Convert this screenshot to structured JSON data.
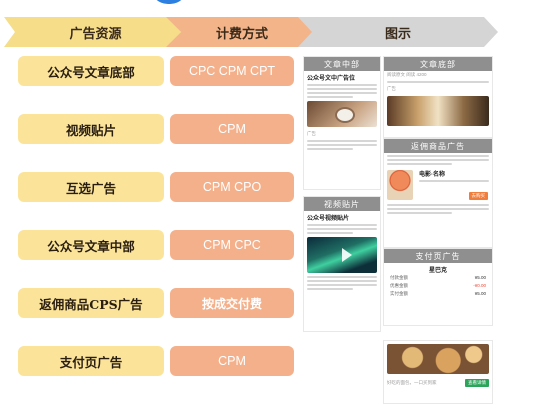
{
  "headers": {
    "source": "广告资源",
    "billing": "计费方式",
    "example": "图示"
  },
  "rows": [
    {
      "source": "公众号文章底部",
      "billing": "CPC CPM CPT"
    },
    {
      "source": "视频贴片",
      "billing": "CPM"
    },
    {
      "source": "互选广告",
      "billing": "CPM CPO"
    },
    {
      "source": "公众号文章中部",
      "billing": "CPM CPC"
    },
    {
      "source": "返佣商品CPS广告",
      "billing": "按成交付费"
    },
    {
      "source": "支付页广告",
      "billing": "CPM"
    }
  ],
  "examples": {
    "article_middle": {
      "tag": "文章中部",
      "title": "公众号文中广告位",
      "ad_label": "广告"
    },
    "video_patch": {
      "tag": "视频贴片",
      "title": "公众号视频贴片"
    },
    "article_bottom": {
      "tag": "文章底部",
      "meta": "阅读原文  阅读 4200",
      "ad_label": "广告"
    },
    "cps": {
      "tag": "返佣商品广告",
      "product": "电影·名称",
      "buy": "去购买"
    },
    "pay_page": {
      "tag": "支付页广告",
      "merchant": "星巴克",
      "rows": [
        {
          "k": "付款金额",
          "v": "¥5.00"
        },
        {
          "k": "优惠金额",
          "v": "-¥0.00"
        },
        {
          "k": "实付金额",
          "v": "¥5.00"
        }
      ],
      "ad_caption": "好吃的面包，一口买到家",
      "ad_button": "查看详情"
    }
  },
  "colors": {
    "source_bg": "#fbe49a",
    "billing_bg": "#f4b08a",
    "example_header": "#d5d5d5",
    "tag_bg": "#8f8f8f"
  }
}
